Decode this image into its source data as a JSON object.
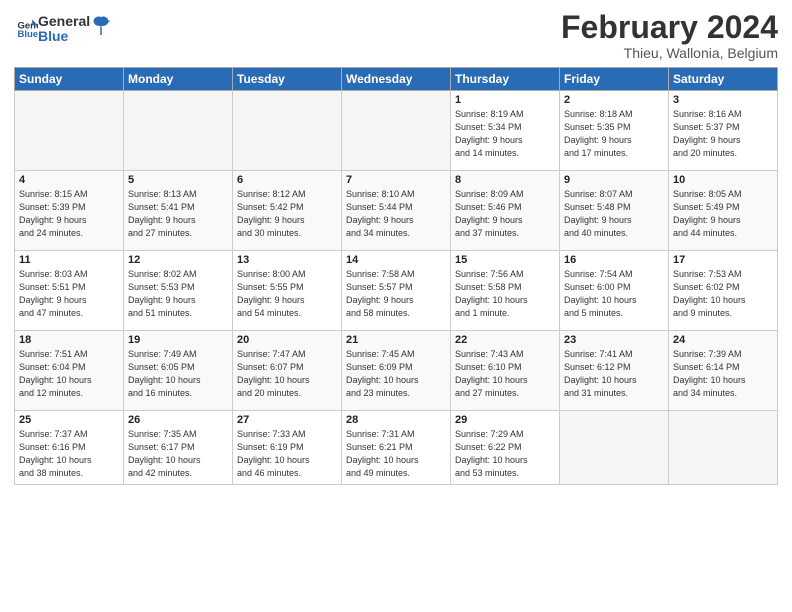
{
  "header": {
    "logo_general": "General",
    "logo_blue": "Blue",
    "month_year": "February 2024",
    "location": "Thieu, Wallonia, Belgium"
  },
  "days_of_week": [
    "Sunday",
    "Monday",
    "Tuesday",
    "Wednesday",
    "Thursday",
    "Friday",
    "Saturday"
  ],
  "weeks": [
    [
      {
        "day": "",
        "info": ""
      },
      {
        "day": "",
        "info": ""
      },
      {
        "day": "",
        "info": ""
      },
      {
        "day": "",
        "info": ""
      },
      {
        "day": "1",
        "info": "Sunrise: 8:19 AM\nSunset: 5:34 PM\nDaylight: 9 hours\nand 14 minutes."
      },
      {
        "day": "2",
        "info": "Sunrise: 8:18 AM\nSunset: 5:35 PM\nDaylight: 9 hours\nand 17 minutes."
      },
      {
        "day": "3",
        "info": "Sunrise: 8:16 AM\nSunset: 5:37 PM\nDaylight: 9 hours\nand 20 minutes."
      }
    ],
    [
      {
        "day": "4",
        "info": "Sunrise: 8:15 AM\nSunset: 5:39 PM\nDaylight: 9 hours\nand 24 minutes."
      },
      {
        "day": "5",
        "info": "Sunrise: 8:13 AM\nSunset: 5:41 PM\nDaylight: 9 hours\nand 27 minutes."
      },
      {
        "day": "6",
        "info": "Sunrise: 8:12 AM\nSunset: 5:42 PM\nDaylight: 9 hours\nand 30 minutes."
      },
      {
        "day": "7",
        "info": "Sunrise: 8:10 AM\nSunset: 5:44 PM\nDaylight: 9 hours\nand 34 minutes."
      },
      {
        "day": "8",
        "info": "Sunrise: 8:09 AM\nSunset: 5:46 PM\nDaylight: 9 hours\nand 37 minutes."
      },
      {
        "day": "9",
        "info": "Sunrise: 8:07 AM\nSunset: 5:48 PM\nDaylight: 9 hours\nand 40 minutes."
      },
      {
        "day": "10",
        "info": "Sunrise: 8:05 AM\nSunset: 5:49 PM\nDaylight: 9 hours\nand 44 minutes."
      }
    ],
    [
      {
        "day": "11",
        "info": "Sunrise: 8:03 AM\nSunset: 5:51 PM\nDaylight: 9 hours\nand 47 minutes."
      },
      {
        "day": "12",
        "info": "Sunrise: 8:02 AM\nSunset: 5:53 PM\nDaylight: 9 hours\nand 51 minutes."
      },
      {
        "day": "13",
        "info": "Sunrise: 8:00 AM\nSunset: 5:55 PM\nDaylight: 9 hours\nand 54 minutes."
      },
      {
        "day": "14",
        "info": "Sunrise: 7:58 AM\nSunset: 5:57 PM\nDaylight: 9 hours\nand 58 minutes."
      },
      {
        "day": "15",
        "info": "Sunrise: 7:56 AM\nSunset: 5:58 PM\nDaylight: 10 hours\nand 1 minute."
      },
      {
        "day": "16",
        "info": "Sunrise: 7:54 AM\nSunset: 6:00 PM\nDaylight: 10 hours\nand 5 minutes."
      },
      {
        "day": "17",
        "info": "Sunrise: 7:53 AM\nSunset: 6:02 PM\nDaylight: 10 hours\nand 9 minutes."
      }
    ],
    [
      {
        "day": "18",
        "info": "Sunrise: 7:51 AM\nSunset: 6:04 PM\nDaylight: 10 hours\nand 12 minutes."
      },
      {
        "day": "19",
        "info": "Sunrise: 7:49 AM\nSunset: 6:05 PM\nDaylight: 10 hours\nand 16 minutes."
      },
      {
        "day": "20",
        "info": "Sunrise: 7:47 AM\nSunset: 6:07 PM\nDaylight: 10 hours\nand 20 minutes."
      },
      {
        "day": "21",
        "info": "Sunrise: 7:45 AM\nSunset: 6:09 PM\nDaylight: 10 hours\nand 23 minutes."
      },
      {
        "day": "22",
        "info": "Sunrise: 7:43 AM\nSunset: 6:10 PM\nDaylight: 10 hours\nand 27 minutes."
      },
      {
        "day": "23",
        "info": "Sunrise: 7:41 AM\nSunset: 6:12 PM\nDaylight: 10 hours\nand 31 minutes."
      },
      {
        "day": "24",
        "info": "Sunrise: 7:39 AM\nSunset: 6:14 PM\nDaylight: 10 hours\nand 34 minutes."
      }
    ],
    [
      {
        "day": "25",
        "info": "Sunrise: 7:37 AM\nSunset: 6:16 PM\nDaylight: 10 hours\nand 38 minutes."
      },
      {
        "day": "26",
        "info": "Sunrise: 7:35 AM\nSunset: 6:17 PM\nDaylight: 10 hours\nand 42 minutes."
      },
      {
        "day": "27",
        "info": "Sunrise: 7:33 AM\nSunset: 6:19 PM\nDaylight: 10 hours\nand 46 minutes."
      },
      {
        "day": "28",
        "info": "Sunrise: 7:31 AM\nSunset: 6:21 PM\nDaylight: 10 hours\nand 49 minutes."
      },
      {
        "day": "29",
        "info": "Sunrise: 7:29 AM\nSunset: 6:22 PM\nDaylight: 10 hours\nand 53 minutes."
      },
      {
        "day": "",
        "info": ""
      },
      {
        "day": "",
        "info": ""
      }
    ]
  ]
}
